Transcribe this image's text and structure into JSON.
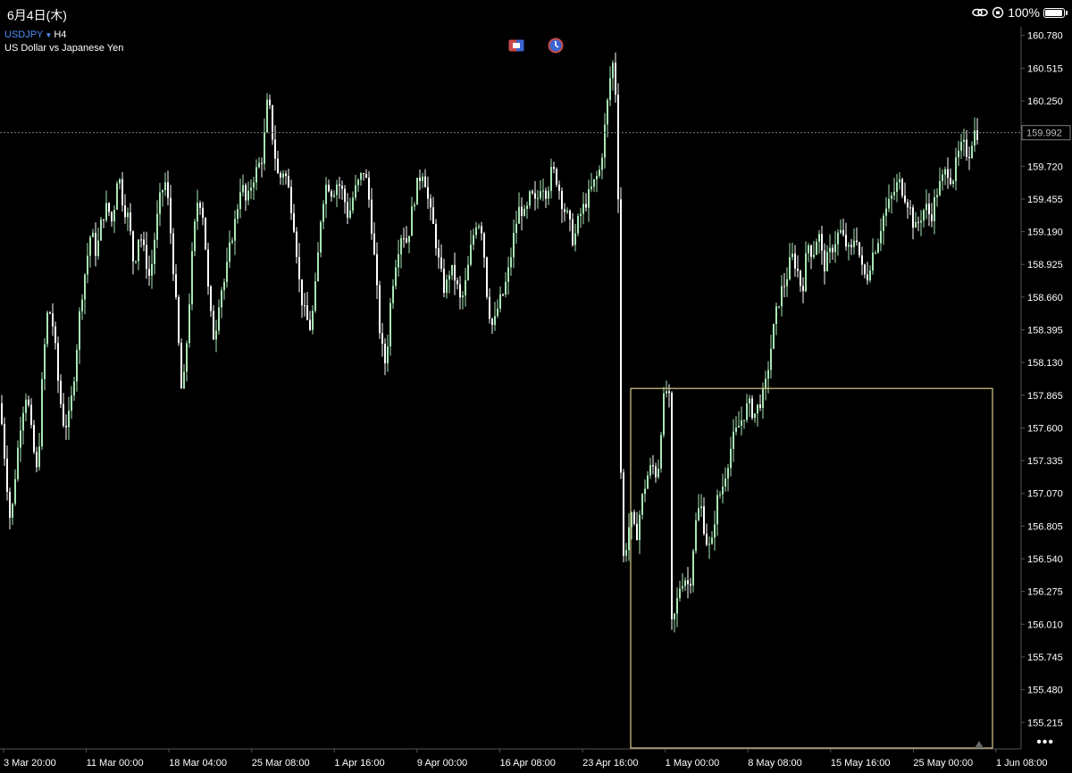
{
  "status_bar": {
    "date": "6月4日(木)",
    "battery_text": "100%",
    "battery_level": 1.0
  },
  "symbol": {
    "ticker": "USDJPY",
    "timeframe": "H4",
    "description": "US Dollar vs Japanese Yen"
  },
  "colors": {
    "background": "#000000",
    "bull_candle": "#a8e6b4",
    "bear_candle": "#ffffff",
    "grid_axis": "#555555",
    "rectangle": "#d6c98a",
    "price_line": "#7a7a7a",
    "symbol_blue": "#4e8ff7"
  },
  "toolbar_icons": [
    "one-click-trading-icon",
    "clock-icon"
  ],
  "chart_data": {
    "type": "candlestick",
    "symbol": "USDJPY",
    "timeframe": "H4",
    "current_price": "159.992",
    "y_ticks": [
      "160.780",
      "160.515",
      "160.250",
      "159.720",
      "159.455",
      "159.190",
      "158.925",
      "158.660",
      "158.395",
      "158.130",
      "157.865",
      "157.600",
      "157.335",
      "157.070",
      "156.805",
      "156.540",
      "156.275",
      "156.010",
      "155.745",
      "155.480",
      "155.215"
    ],
    "ylim": [
      155.0,
      160.85
    ],
    "x_ticks": [
      "3 Mar 20:00",
      "11 Mar 00:00",
      "18 Mar 04:00",
      "25 Mar 08:00",
      "1 Apr 16:00",
      "9 Apr 00:00",
      "16 Apr 08:00",
      "23 Apr 16:00",
      "1 May 00:00",
      "8 May 08:00",
      "15 May 16:00",
      "25 May 00:00",
      "1 Jun 08:00"
    ],
    "close_path": [
      [
        0,
        157.8
      ],
      [
        6,
        157.3
      ],
      [
        12,
        156.8
      ],
      [
        18,
        157.3
      ],
      [
        24,
        157.7
      ],
      [
        30,
        157.9
      ],
      [
        36,
        157.5
      ],
      [
        42,
        157.2
      ],
      [
        48,
        158.1
      ],
      [
        54,
        158.6
      ],
      [
        60,
        158.4
      ],
      [
        66,
        157.9
      ],
      [
        72,
        157.6
      ],
      [
        78,
        157.7
      ],
      [
        84,
        158.1
      ],
      [
        90,
        158.6
      ],
      [
        96,
        158.9
      ],
      [
        102,
        159.2
      ],
      [
        108,
        159.0
      ],
      [
        114,
        159.3
      ],
      [
        120,
        159.4
      ],
      [
        126,
        159.25
      ],
      [
        132,
        159.7
      ],
      [
        138,
        159.4
      ],
      [
        144,
        159.3
      ],
      [
        150,
        158.9
      ],
      [
        156,
        159.2
      ],
      [
        162,
        159.0
      ],
      [
        168,
        158.8
      ],
      [
        174,
        159.2
      ],
      [
        180,
        159.5
      ],
      [
        186,
        159.6
      ],
      [
        192,
        159.1
      ],
      [
        198,
        158.5
      ],
      [
        204,
        157.8
      ],
      [
        210,
        158.4
      ],
      [
        216,
        159.1
      ],
      [
        222,
        159.5
      ],
      [
        228,
        159.3
      ],
      [
        234,
        158.6
      ],
      [
        240,
        158.3
      ],
      [
        246,
        158.7
      ],
      [
        252,
        158.8
      ],
      [
        258,
        159.1
      ],
      [
        264,
        159.3
      ],
      [
        270,
        159.6
      ],
      [
        276,
        159.4
      ],
      [
        282,
        159.6
      ],
      [
        288,
        159.7
      ],
      [
        294,
        159.8
      ],
      [
        300,
        160.3
      ],
      [
        306,
        159.9
      ],
      [
        312,
        159.6
      ],
      [
        318,
        159.7
      ],
      [
        324,
        159.5
      ],
      [
        330,
        159.2
      ],
      [
        336,
        158.7
      ],
      [
        342,
        158.5
      ],
      [
        348,
        158.4
      ],
      [
        354,
        158.8
      ],
      [
        360,
        159.4
      ],
      [
        366,
        159.6
      ],
      [
        372,
        159.5
      ],
      [
        378,
        159.6
      ],
      [
        384,
        159.5
      ],
      [
        390,
        159.3
      ],
      [
        396,
        159.5
      ],
      [
        402,
        159.6
      ],
      [
        408,
        159.7
      ],
      [
        414,
        159.4
      ],
      [
        420,
        158.9
      ],
      [
        426,
        158.3
      ],
      [
        432,
        158.1
      ],
      [
        438,
        158.7
      ],
      [
        444,
        159.0
      ],
      [
        450,
        159.2
      ],
      [
        456,
        159.1
      ],
      [
        462,
        159.4
      ],
      [
        468,
        159.6
      ],
      [
        474,
        159.7
      ],
      [
        480,
        159.4
      ],
      [
        486,
        159.2
      ],
      [
        492,
        158.9
      ],
      [
        498,
        158.7
      ],
      [
        504,
        158.9
      ],
      [
        510,
        158.8
      ],
      [
        516,
        158.6
      ],
      [
        522,
        158.8
      ],
      [
        528,
        159.1
      ],
      [
        534,
        159.3
      ],
      [
        540,
        159.2
      ],
      [
        546,
        158.6
      ],
      [
        552,
        158.4
      ],
      [
        558,
        158.6
      ],
      [
        564,
        158.7
      ],
      [
        570,
        158.9
      ],
      [
        576,
        159.2
      ],
      [
        582,
        159.4
      ],
      [
        588,
        159.3
      ],
      [
        594,
        159.5
      ],
      [
        600,
        159.4
      ],
      [
        606,
        159.6
      ],
      [
        612,
        159.5
      ],
      [
        618,
        159.7
      ],
      [
        624,
        159.6
      ],
      [
        630,
        159.4
      ],
      [
        636,
        159.3
      ],
      [
        642,
        159.1
      ],
      [
        648,
        159.3
      ],
      [
        654,
        159.4
      ],
      [
        660,
        159.5
      ],
      [
        666,
        159.6
      ],
      [
        672,
        159.7
      ],
      [
        678,
        160.1
      ],
      [
        684,
        160.5
      ],
      [
        688,
        160.6
      ],
      [
        692,
        159.5
      ],
      [
        696,
        156.5
      ],
      [
        700,
        156.6
      ],
      [
        706,
        156.9
      ],
      [
        712,
        156.7
      ],
      [
        718,
        157.0
      ],
      [
        724,
        157.2
      ],
      [
        730,
        157.3
      ],
      [
        736,
        157.2
      ],
      [
        742,
        157.8
      ],
      [
        746,
        157.9
      ],
      [
        750,
        157.8
      ],
      [
        752,
        156.0
      ],
      [
        756,
        156.1
      ],
      [
        760,
        156.3
      ],
      [
        766,
        156.4
      ],
      [
        772,
        156.3
      ],
      [
        778,
        156.8
      ],
      [
        784,
        157.0
      ],
      [
        790,
        156.7
      ],
      [
        796,
        156.6
      ],
      [
        802,
        157.0
      ],
      [
        808,
        157.1
      ],
      [
        814,
        157.3
      ],
      [
        820,
        157.5
      ],
      [
        826,
        157.6
      ],
      [
        832,
        157.7
      ],
      [
        838,
        157.8
      ],
      [
        844,
        157.7
      ],
      [
        850,
        157.8
      ],
      [
        856,
        157.9
      ],
      [
        862,
        158.2
      ],
      [
        868,
        158.5
      ],
      [
        874,
        158.7
      ],
      [
        880,
        158.8
      ],
      [
        886,
        159.0
      ],
      [
        892,
        158.9
      ],
      [
        898,
        158.7
      ],
      [
        904,
        159.1
      ],
      [
        910,
        159.0
      ],
      [
        916,
        159.2
      ],
      [
        922,
        158.9
      ],
      [
        928,
        159.0
      ],
      [
        934,
        159.1
      ],
      [
        940,
        159.2
      ],
      [
        946,
        159.1
      ],
      [
        952,
        159.0
      ],
      [
        958,
        159.2
      ],
      [
        964,
        158.9
      ],
      [
        970,
        158.8
      ],
      [
        976,
        159.0
      ],
      [
        982,
        159.1
      ],
      [
        988,
        159.3
      ],
      [
        994,
        159.4
      ],
      [
        1000,
        159.5
      ],
      [
        1006,
        159.6
      ],
      [
        1012,
        159.5
      ],
      [
        1018,
        159.4
      ],
      [
        1024,
        159.2
      ],
      [
        1030,
        159.3
      ],
      [
        1036,
        159.4
      ],
      [
        1042,
        159.3
      ],
      [
        1048,
        159.5
      ],
      [
        1054,
        159.6
      ],
      [
        1060,
        159.7
      ],
      [
        1066,
        159.6
      ],
      [
        1072,
        159.8
      ],
      [
        1078,
        159.9
      ],
      [
        1084,
        159.8
      ],
      [
        1090,
        160.0
      ],
      [
        1094,
        159.99
      ]
    ]
  },
  "rectangle_object": {
    "label": "selection-rectangle",
    "price_top": 157.92,
    "price_bottom": 155.0
  }
}
